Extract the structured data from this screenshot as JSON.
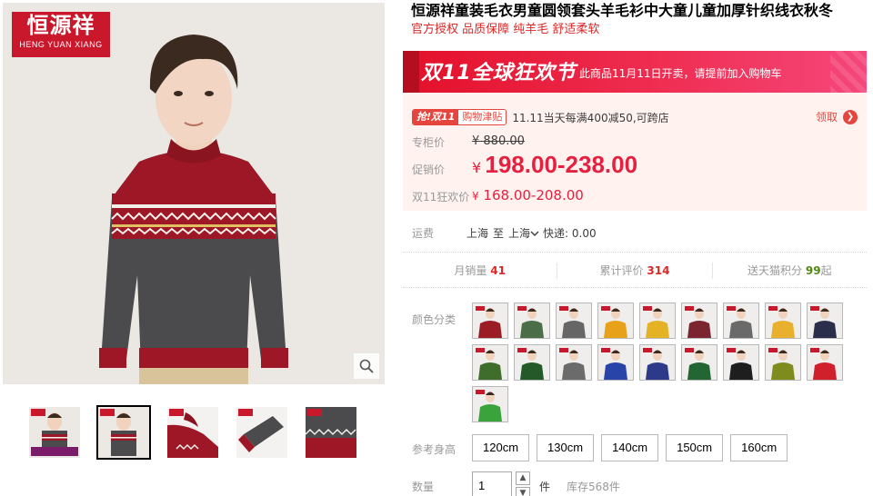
{
  "brand": {
    "name": "恒源祥",
    "name_en": "HENG YUAN XIANG"
  },
  "product": {
    "title": "恒源祥童装毛衣男童圆领套头羊毛衫中大童儿童加厚针织线衣秋冬",
    "subtitle": "官方授权 品质保障 纯羊毛 舒适柔软"
  },
  "banner": {
    "logo_text": "双11全球狂欢节",
    "note": "此商品11月11日开卖，请提前加入购物车"
  },
  "allowance": {
    "tag_left": "抢!双11",
    "tag_right": "购物津贴",
    "desc": "11.11当天每满400减50,可跨店",
    "claim": "领取",
    "claim_icon": "chevron-right-icon"
  },
  "price": {
    "orig_label": "专柜价",
    "orig_value": "¥ 880.00",
    "promo_label": "促销价",
    "currency": "¥",
    "promo_value": "198.00-238.00",
    "event_label": "双11狂欢价",
    "event_value": "168.00-208.00",
    "accent_color": "#e5213f"
  },
  "shipping": {
    "label": "运费",
    "origin": "上海",
    "to": "至",
    "dest": "上海",
    "courier": "快递: 0.00"
  },
  "stats": [
    {
      "label": "月销量",
      "value": "41"
    },
    {
      "label": "累计评价",
      "value": "314"
    },
    {
      "label": "送天猫积分",
      "value": "99",
      "suffix": "起"
    }
  ],
  "sku": {
    "color_label": "颜色分类",
    "size_label": "参考身高",
    "sizes": [
      "120cm",
      "130cm",
      "140cm",
      "150cm",
      "160cm"
    ],
    "qty_label": "数量",
    "qty_value": "1",
    "unit": "件",
    "stock": "库存568件",
    "swatch_colors": [
      "#9c1c25",
      "#4b6e48",
      "#666666",
      "#e8a21a",
      "#e3b325",
      "#7a2530",
      "#6a6a6a",
      "#e8b02c",
      "#2b2e4a",
      "#3f6e2c",
      "#245a2a",
      "#6b6b6b",
      "#2844a8",
      "#2d3a8a",
      "#236634",
      "#1e1e1e",
      "#7d8c1c",
      "#d0202c",
      "#3aa33c"
    ]
  }
}
